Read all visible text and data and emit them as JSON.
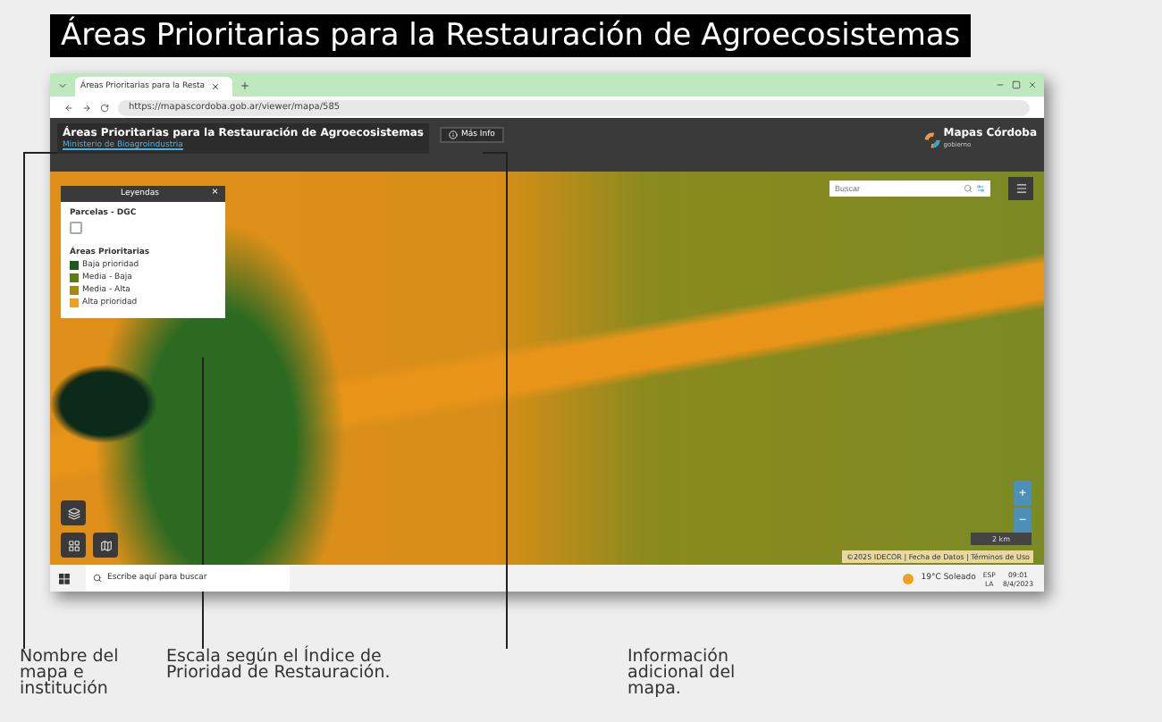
{
  "title": "Áreas Prioritarias para la Restauración de Agroecosistemas",
  "browser": {
    "tab": "Áreas Prioritarias para la Resta",
    "url": "https://mapascordoba.gob.ar/viewer/mapa/585"
  },
  "map_header": {
    "title": "Áreas Prioritarias para la Restauración de Agroecosistemas",
    "subtitle": "Ministerio de Bioagroindustria",
    "info_button": "Más Info",
    "logo": "Mapas Córdoba",
    "logo_sub": "gobierno"
  },
  "legend": {
    "title": "Leyendas",
    "close": "×",
    "layers": [
      {
        "label": "Parcelas - DGC",
        "checked": false
      }
    ],
    "section": "Áreas Prioritarias",
    "items": [
      {
        "label": "Baja prioridad",
        "color": "#1e5a1a"
      },
      {
        "label": "Media - Baja",
        "color": "#5e7a12"
      },
      {
        "label": "Media - Alta",
        "color": "#a08a14"
      },
      {
        "label": "Alta prioridad",
        "color": "#f0a020"
      }
    ]
  },
  "search": {
    "placeholder": "Buscar"
  },
  "zoom": [
    "+",
    "−"
  ],
  "scale": "2 km",
  "attribution": "©2025 IDECOR | Fecha de Datos | Términos de Uso",
  "taskbar": {
    "search_placeholder": "Escribe aquí para buscar",
    "weather": "19°C Soleado",
    "lang": [
      "ESP",
      "LA"
    ],
    "clock": [
      "09:01",
      "8/4/2023"
    ]
  },
  "captions": [
    "Nombre del mapa e institución",
    "Escala según el Índice de Prioridad de Restauración.",
    "Información adicional del mapa."
  ]
}
